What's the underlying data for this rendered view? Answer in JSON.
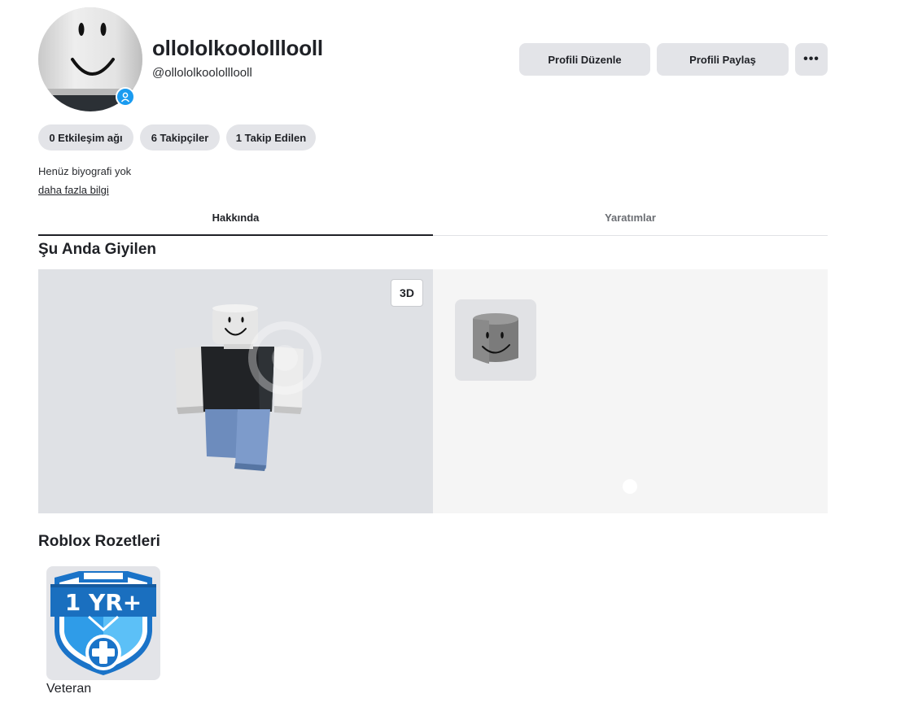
{
  "profile": {
    "display_name": "ollololkoololllooll",
    "username": "@ollololkoololllooll",
    "verified_icon": "user-badge-icon"
  },
  "actions": {
    "edit_label": "Profili Düzenle",
    "share_label": "Profili Paylaş",
    "more_label": "•••"
  },
  "stats": [
    {
      "label": "0 Etkileşim ağı"
    },
    {
      "label": "6 Takipçiler"
    },
    {
      "label": "1 Takip Edilen"
    }
  ],
  "bio": {
    "text": "Henüz biyografi yok",
    "more_link": "daha fazla bilgi"
  },
  "tabs": [
    {
      "label": "Hakkında",
      "active": true
    },
    {
      "label": "Yaratımlar",
      "active": false
    }
  ],
  "wearing": {
    "title": "Şu Anda Giyilen",
    "view_toggle": "3D",
    "items": [
      {
        "icon": "smiley-head-icon"
      }
    ]
  },
  "badges": {
    "title": "Roblox Rozetleri",
    "items": [
      {
        "name": "Veteran",
        "emblem_text": "1 YR+"
      }
    ]
  },
  "colors": {
    "accent": "#1a9bf0",
    "button_bg": "#e3e4e8",
    "badge_blue": "#1a73c8"
  }
}
